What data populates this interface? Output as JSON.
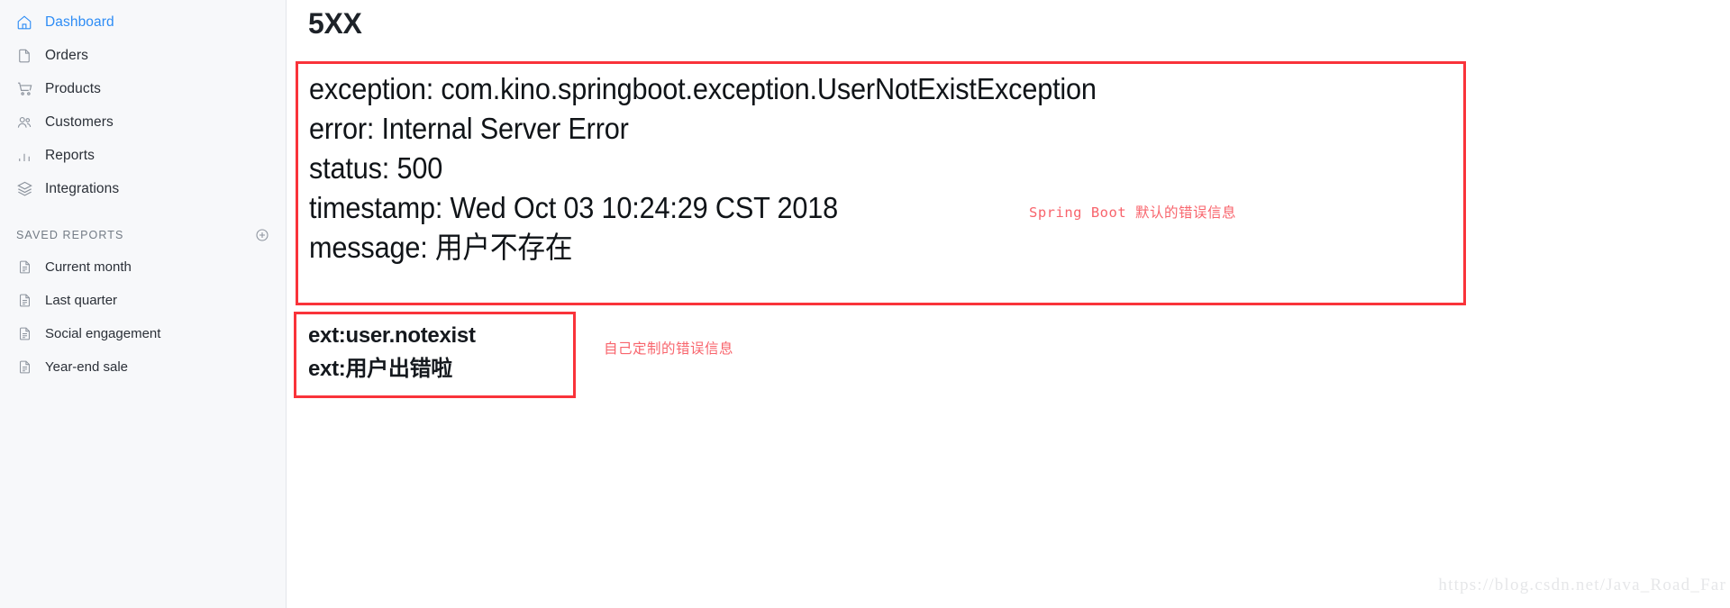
{
  "sidebar": {
    "nav_items": [
      {
        "label": "Dashboard",
        "icon": "home-icon",
        "active": true
      },
      {
        "label": "Orders",
        "icon": "document-icon",
        "active": false
      },
      {
        "label": "Products",
        "icon": "cart-icon",
        "active": false
      },
      {
        "label": "Customers",
        "icon": "users-icon",
        "active": false
      },
      {
        "label": "Reports",
        "icon": "bar-chart-icon",
        "active": false
      },
      {
        "label": "Integrations",
        "icon": "layers-icon",
        "active": false
      }
    ],
    "saved_reports_title": "SAVED REPORTS",
    "saved_reports_add_icon": "plus-circle-icon",
    "saved_reports": [
      {
        "label": "Current month",
        "icon": "report-file-icon"
      },
      {
        "label": "Last quarter",
        "icon": "report-file-icon"
      },
      {
        "label": "Social engagement",
        "icon": "report-file-icon"
      },
      {
        "label": "Year-end sale",
        "icon": "report-file-icon"
      }
    ],
    "accent_color": "#2d8cf5",
    "background_color": "#f7f8fa"
  },
  "main": {
    "page_title": "5XX",
    "default_error": {
      "lines": [
        "exception: com.kino.springboot.exception.UserNotExistException",
        "error: Internal Server Error",
        "status: 500",
        "timestamp: Wed Oct 03 10:24:29 CST 2018",
        "message: 用户不存在"
      ],
      "annotation": "Spring Boot 默认的错误信息",
      "border_color": "#f9333a"
    },
    "custom_error": {
      "lines": [
        "ext:user.notexist",
        "ext:用户出错啦"
      ],
      "annotation": "自己定制的错误信息",
      "border_color": "#f9333a"
    },
    "annotation_color": "#f8646c"
  },
  "watermark": "https://blog.csdn.net/Java_Road_Far"
}
